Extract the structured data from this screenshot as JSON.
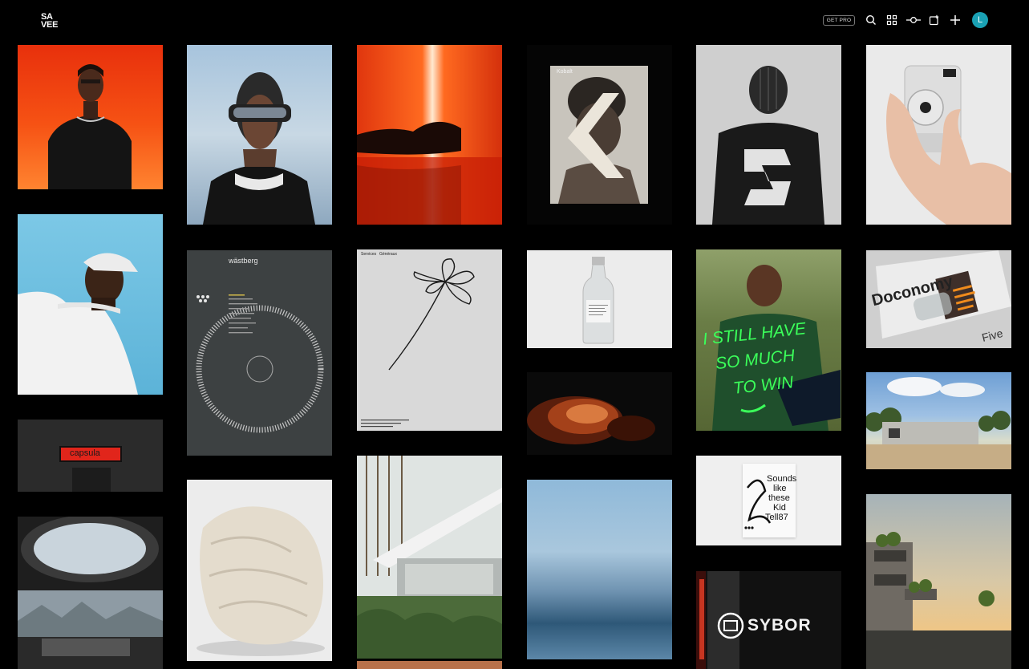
{
  "app": {
    "logo_line1": "SA",
    "logo_line2": "VEE"
  },
  "header": {
    "get_pro_label": "GET PRO",
    "avatar_initial": "L"
  },
  "tiles": {
    "kobalt_label": "Kobalt",
    "wastberg_label": "wästberg",
    "services_label": "Services",
    "generaux_label": "Généraux",
    "capsula_label": "capsula",
    "still_have_line1": "I STILL HAVE",
    "still_have_line2": "SO MUCH",
    "still_have_line3": "TO WIN",
    "doconomy_label": "Doconomy",
    "five_label": "Five",
    "sounds_line1": "Sounds",
    "sounds_line2": "like",
    "sounds_line3": "these",
    "sounds_line4": "Kid",
    "sounds_line5": "Tell87",
    "sybor_label": "SYBOR"
  },
  "colors": {
    "background": "#000000",
    "avatar": "#1aa1b4"
  }
}
